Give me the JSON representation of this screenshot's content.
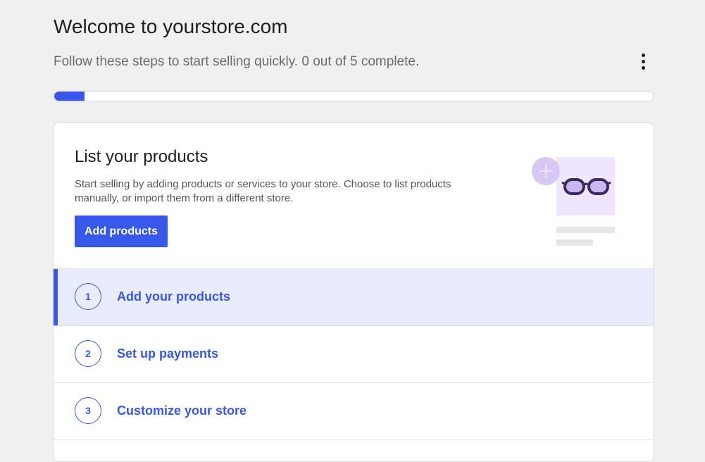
{
  "header": {
    "title": "Welcome to yourstore.com",
    "subtitle": "Follow these steps to start selling quickly. 0 out of 5 complete.",
    "more_icon": "more-vertical-icon"
  },
  "progress": {
    "completed": 0,
    "total": 5,
    "fill_fraction": 0.05,
    "color": "#3858e9"
  },
  "hero": {
    "title": "List your products",
    "description": "Start selling by adding products or services to your store. Choose to list products manually, or import them from a different store.",
    "button_label": "Add products",
    "illustration_icon": "glasses-product-icon",
    "plus_icon": "plus-icon"
  },
  "steps": [
    {
      "number": "1",
      "label": "Add your products",
      "active": true
    },
    {
      "number": "2",
      "label": "Set up payments",
      "active": false
    },
    {
      "number": "3",
      "label": "Customize your store",
      "active": false
    }
  ],
  "colors": {
    "accent": "#3858e9",
    "accent_bg": "#e9ecfc",
    "illustration_purple": "#d6c8f5"
  }
}
